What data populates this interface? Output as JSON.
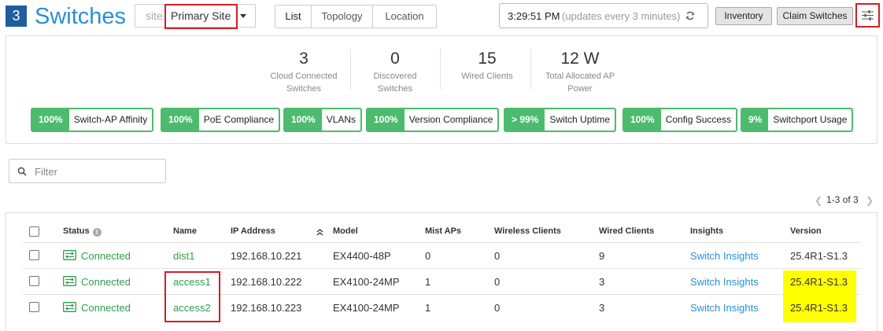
{
  "header": {
    "count": "3",
    "title": "Switches",
    "site_prefix": "site",
    "site_value": "Primary Site",
    "tabs": [
      "List",
      "Topology",
      "Location"
    ],
    "clock_time": "3:29:51 PM",
    "clock_note": "(updates every 3 minutes)",
    "inventory_label": "Inventory",
    "claim_label": "Claim Switches"
  },
  "summary": {
    "stats": [
      {
        "value": "3",
        "label_line1": "Cloud Connected",
        "label_line2": "Switches"
      },
      {
        "value": "0",
        "label_line1": "Discovered",
        "label_line2": "Switches"
      },
      {
        "value": "15",
        "label_line1": "Wired Clients",
        "label_line2": ""
      },
      {
        "value": "12 W",
        "label_line1": "Total Allocated AP",
        "label_line2": "Power"
      }
    ],
    "sles": [
      {
        "pct": "100%",
        "name": "Switch-AP Affinity"
      },
      {
        "pct": "100%",
        "name": "PoE Compliance"
      },
      {
        "pct": "100%",
        "name": "VLANs"
      },
      {
        "pct": "100%",
        "name": "Version Compliance"
      },
      {
        "pct": "> 99%",
        "name": "Switch Uptime"
      },
      {
        "pct": "100%",
        "name": "Config Success"
      },
      {
        "pct": "9%",
        "name": "Switchport Usage"
      }
    ]
  },
  "filter": {
    "placeholder": "Filter"
  },
  "pager": {
    "text": "1-3 of 3"
  },
  "table": {
    "columns": [
      "Status",
      "Name",
      "IP Address",
      "Model",
      "Mist APs",
      "Wireless Clients",
      "Wired Clients",
      "Insights",
      "Version"
    ],
    "rows": [
      {
        "status": "Connected",
        "name": "dist1",
        "ip": "192.168.10.221",
        "model": "EX4400-48P",
        "mist_aps": "0",
        "wireless": "0",
        "wired": "9",
        "insights": "Switch Insights",
        "version": "25.4R1-S1.3"
      },
      {
        "status": "Connected",
        "name": "access1",
        "ip": "192.168.10.222",
        "model": "EX4100-24MP",
        "mist_aps": "1",
        "wireless": "0",
        "wired": "3",
        "insights": "Switch Insights",
        "version": "25.4R1-S1.3"
      },
      {
        "status": "Connected",
        "name": "access2",
        "ip": "192.168.10.223",
        "model": "EX4100-24MP",
        "mist_aps": "1",
        "wireless": "0",
        "wired": "3",
        "insights": "Switch Insights",
        "version": "25.4R1-S1.3"
      }
    ]
  },
  "colors": {
    "accent": "#2a8fd6",
    "sle_green": "#4cbb6e",
    "status_green": "#2e9e4e",
    "highlight_red": "#d21f26",
    "highlight_yellow": "#ffff00"
  }
}
